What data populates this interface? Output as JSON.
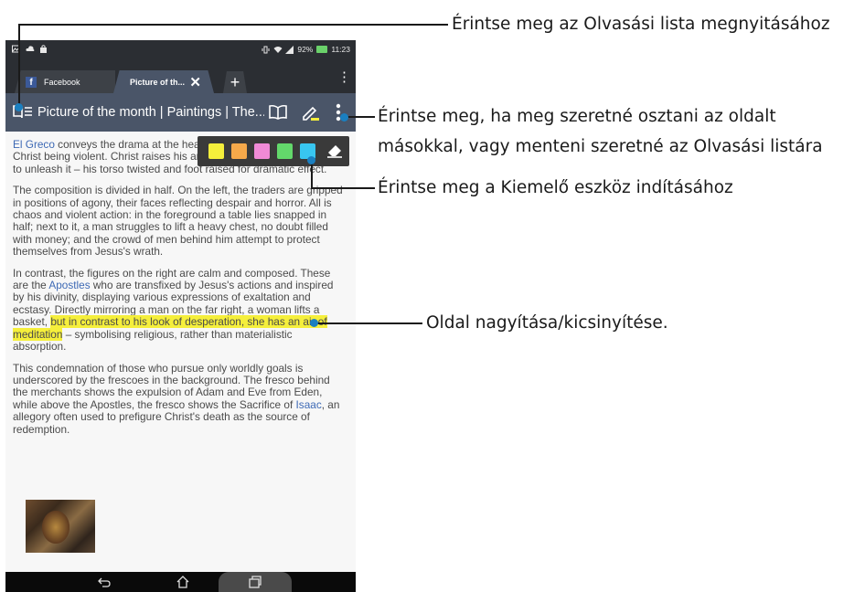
{
  "status_bar": {
    "battery": "92%",
    "time": "11:23"
  },
  "tabs": [
    {
      "label": "Facebook",
      "icon": "facebook-icon"
    },
    {
      "label": "Picture of th...",
      "icon": "close-icon"
    }
  ],
  "new_tab_label": "+",
  "toolbar": {
    "title": "Picture of the month | Paintings | The..."
  },
  "article": {
    "p1": {
      "link": "El Greco",
      "text": " conveys the drama at the heart of the story. The shock of Christ being violent. Christ raises his arm to flail and is poised ready to unleash it – his torso twisted and foot raised for dramatic effect."
    },
    "p2": "The composition is divided in half. On the left, the traders are gripped in positions of agony, their faces reflecting despair and horror. All is chaos and violent action: in the foreground a table lies snapped in half; next to it, a man struggles to lift a heavy chest, no doubt filled with money; and the crowd of men behind him attempt to protect themselves from Jesus's wrath.",
    "p3": {
      "a": "In contrast, the figures on the right are calm and composed. These are the ",
      "link": "Apostles",
      "b": " who are transfixed by Jesus's actions and inspired by his divinity, displaying various expressions of exaltation and ecstasy. Directly mirroring a man on the far right, a woman lifts a basket, ",
      "highlight": "but in contrast to his look of desperation, she has an air of meditation",
      "c": " – symbolising religious, rather than materialistic absorption."
    },
    "p4": {
      "a": "This condemnation of those who pursue only worldly goals is underscored by the frescoes in the background. The fresco behind the merchants shows the expulsion of Adam and Eve from Eden, while above the Apostles, the fresco shows the Sacrifice of ",
      "link": "Isaac",
      "b": ", an allegory often used to prefigure Christ's death as the source of redemption."
    }
  },
  "highlight_colors": [
    "#f5ef3b",
    "#f6a94a",
    "#f08ad6",
    "#63d86b",
    "#38c6f0"
  ],
  "colors": {
    "toolbar": "#4a5568",
    "link": "#3e6ab5",
    "callout_dot": "#1a7fc0"
  },
  "callouts": {
    "reading_list": "Érintse meg az Olvasási lista megnyitásához",
    "share_line1": "Érintse meg, ha meg szeretné osztani az oldalt",
    "share_line2": "másokkal, vagy menteni szeretné az Olvasási listára",
    "highlighter": "Érintse meg a Kiemelő eszköz indításához",
    "zoom": "Oldal nagyítása/kicsinyítése."
  }
}
